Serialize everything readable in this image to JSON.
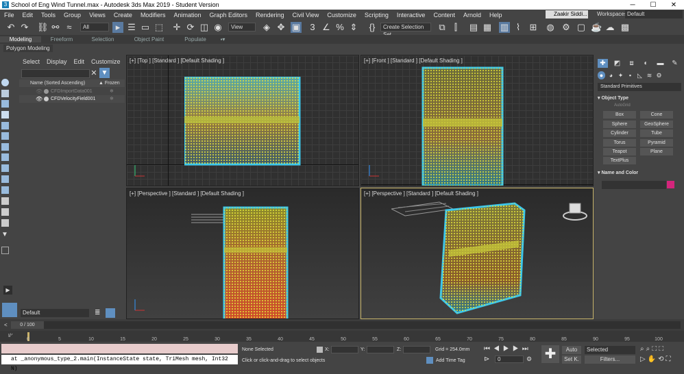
{
  "window": {
    "title": "School of Eng Wind Tunnel.max - Autodesk 3ds Max 2019 - Student Version",
    "app_icon": "3",
    "min": "─",
    "max": "☐",
    "close": "✕"
  },
  "menu": [
    "File",
    "Edit",
    "Tools",
    "Group",
    "Views",
    "Create",
    "Modifiers",
    "Animation",
    "Graph Editors",
    "Rendering",
    "Civil View",
    "Customize",
    "Scripting",
    "Interactive",
    "Content",
    "Arnold",
    "Help"
  ],
  "user": "Zaakir Siddi...",
  "workspaces_label": "Workspaces:",
  "workspaces_value": "Default",
  "toolbar": {
    "filter": "All",
    "ref_coord": "View",
    "selection_set": "Create Selection Set"
  },
  "ribbon_tabs": [
    "Modeling",
    "Freeform",
    "Selection",
    "Object Paint",
    "Populate"
  ],
  "ribbon_sub": "Polygon Modeling",
  "explorer": {
    "menu": [
      "Select",
      "Display",
      "Edit",
      "Customize"
    ],
    "col_name": "Name (Sorted Ascending)",
    "col_frozen": "▲ Frozen",
    "rows": [
      {
        "name": "CFDImportData001"
      },
      {
        "name": "CFDVelocityField001"
      }
    ]
  },
  "viewports": {
    "top": "[+] [Top ] [Standard ] [Default Shading ]",
    "front": "[+] [Front ] [Standard ] [Default Shading ]",
    "persp1": "[+] [Perspective ] [Standard ] [Default Shading ]",
    "persp2": "[+] [Perspective ] [Standard ] [Default Shading ]"
  },
  "command_panel": {
    "dropdown": "Standard Primitives",
    "object_type_header": "Object Type",
    "autogrid": "AutoGrid",
    "buttons": [
      "Box",
      "Cone",
      "Sphere",
      "GeoSphere",
      "Cylinder",
      "Tube",
      "Torus",
      "Pyramid",
      "Teapot",
      "Plane",
      "TextPlus"
    ],
    "name_color_header": "Name and Color",
    "color": "#d4257c"
  },
  "layer": "Default",
  "time": {
    "slider": "0 / 100",
    "ticks": [
      "0",
      "5",
      "10",
      "15",
      "20",
      "25",
      "30",
      "35",
      "40",
      "45",
      "50",
      "55",
      "60",
      "65",
      "70",
      "75",
      "80",
      "85",
      "90",
      "95",
      "100"
    ]
  },
  "status": {
    "maxscript": "at _anonymous_type_2.main(InstanceState state, TriMesh mesh, Int32 N)",
    "selection": "None Selected",
    "prompt": "Click or click-and-drag to select objects",
    "x": "X:",
    "y": "Y:",
    "z": "Z:",
    "grid": "Grid = 254.0mm",
    "add_time_tag": "Add Time Tag",
    "auto": "Auto",
    "setk": "Set K.",
    "selected": "Selected",
    "filters": "Filters...",
    "frame": "0"
  }
}
